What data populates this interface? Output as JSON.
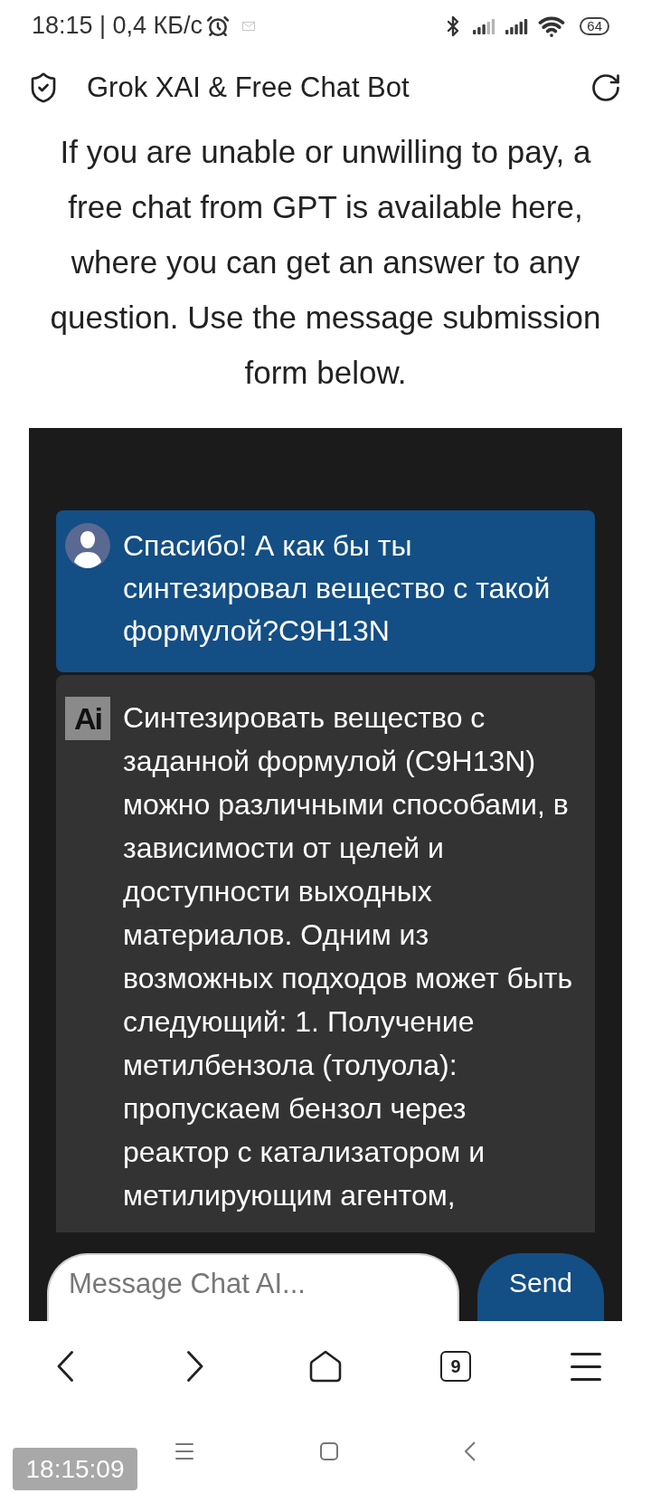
{
  "status_bar": {
    "text": "18:15 | 0,4 КБ/с",
    "battery": "64"
  },
  "header": {
    "title": "Grok XAI & Free Chat Bot"
  },
  "intro": "If you are unable or unwilling to pay, a free chat from GPT is available here, where you can get an answer to any question. Use the message submission form below.",
  "chat": {
    "messages": [
      {
        "kind": "user",
        "text": "Спасибо! А как бы ты синтезировал вещество с такой формулой?C9H13N"
      },
      {
        "kind": "assistant",
        "avatar": "Ai",
        "text": "Синтезировать вещество с заданной формулой (C9H13N) можно различными способами, в зависимости от целей и доступности выходных материалов. Одним из возможных подходов может быть следующий: 1. Получение метилбензола (толуола): пропускаем бензол через реактор с катализатором и метилирующим агентом,"
      }
    ],
    "input": {
      "placeholder": "Message Chat AI..."
    },
    "send_button": "Send"
  },
  "browser_toolbar": {
    "tab_count": "9"
  },
  "timestamp": "18:15:09"
}
